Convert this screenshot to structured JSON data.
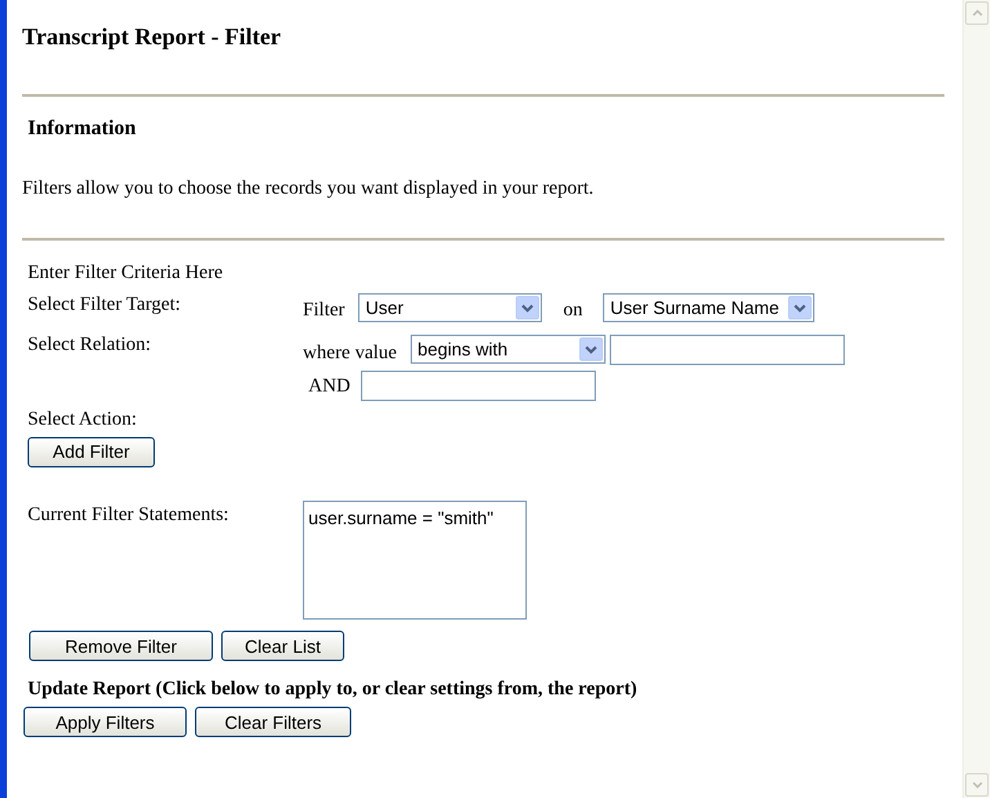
{
  "title": "Transcript Report - Filter",
  "information": {
    "heading": "Information",
    "text": "Filters allow you to choose the records you want displayed in your report."
  },
  "criteria": {
    "heading": "Enter Filter Criteria Here",
    "target": {
      "label": "Select Filter Target:",
      "prefix": "Filter",
      "select": "User",
      "joiner": "on",
      "field_select": "User Surname Name"
    },
    "relation": {
      "label": "Select Relation:",
      "prefix": "where value",
      "select": "begins with",
      "and_label": "AND"
    },
    "action": {
      "label": "Select Action:",
      "button": "Add Filter"
    }
  },
  "current": {
    "label": "Current Filter Statements:",
    "items": [
      "user.surname = \"smith\""
    ],
    "buttons": [
      "Remove Filter",
      "Clear List"
    ]
  },
  "update": {
    "heading": "Update Report (Click below to apply to, or clear settings from, the report)",
    "buttons": [
      "Apply Filters",
      "Clear Filters"
    ]
  }
}
